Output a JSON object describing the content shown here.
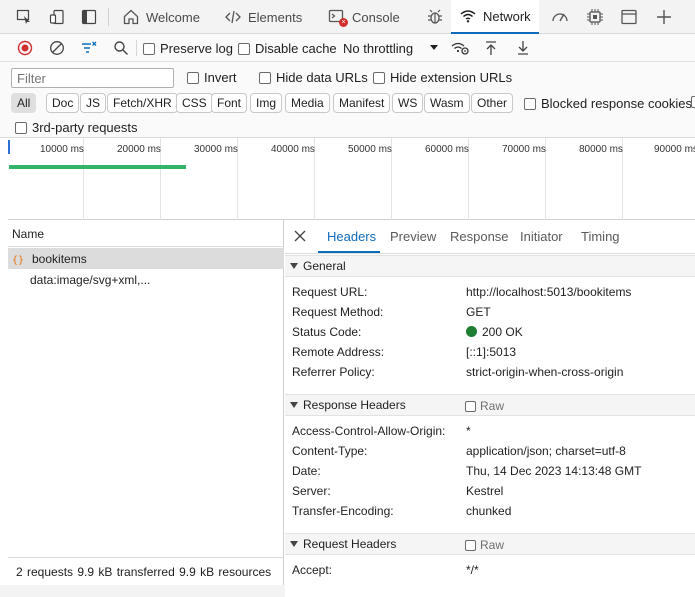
{
  "tabbar": {
    "tabs": [
      {
        "label": "Welcome",
        "icon": "home-icon"
      },
      {
        "label": "Elements",
        "icon": "code-icon"
      },
      {
        "label": "Console",
        "icon": "console-icon"
      },
      {
        "label": "Network",
        "icon": "wifi-icon",
        "active": true
      }
    ]
  },
  "toolbar": {
    "preserve_log": "Preserve log",
    "disable_cache": "Disable cache",
    "throttling": "No throttling"
  },
  "filter": {
    "placeholder": "Filter",
    "invert": "Invert",
    "hide_data_urls": "Hide data URLs",
    "hide_extension_urls": "Hide extension URLs"
  },
  "type_filters": [
    "All",
    "Doc",
    "JS",
    "Fetch/XHR",
    "CSS",
    "Font",
    "Img",
    "Media",
    "Manifest",
    "WS",
    "Wasm",
    "Other"
  ],
  "blocked_response_cookies": "Blocked response cookies",
  "third_party": "3rd-party requests",
  "overview": {
    "ticks": [
      "10000 ms",
      "20000 ms",
      "30000 ms",
      "40000 ms",
      "50000 ms",
      "60000 ms",
      "70000 ms",
      "80000 ms",
      "90000 ms"
    ]
  },
  "requests": {
    "header": "Name",
    "items": [
      {
        "name": "bookitems",
        "icon": "fetch-braces-icon"
      },
      {
        "name": "data:image/svg+xml,..."
      }
    ],
    "summary": "2 requests  9.9 kB transferred  9.9 kB resources"
  },
  "detail": {
    "tabs": [
      "Headers",
      "Preview",
      "Response",
      "Initiator",
      "Timing"
    ],
    "general": {
      "title": "General",
      "rows": [
        {
          "key": "Request URL:",
          "value": "http://localhost:5013/bookitems"
        },
        {
          "key": "Request Method:",
          "value": "GET"
        },
        {
          "key": "Status Code:",
          "value": "200 OK"
        },
        {
          "key": "Remote Address:",
          "value": "[::1]:5013"
        },
        {
          "key": "Referrer Policy:",
          "value": "strict-origin-when-cross-origin"
        }
      ]
    },
    "response_headers": {
      "title": "Response Headers",
      "raw": "Raw",
      "rows": [
        {
          "key": "Access-Control-Allow-Origin:",
          "value": "*"
        },
        {
          "key": "Content-Type:",
          "value": "application/json; charset=utf-8"
        },
        {
          "key": "Date:",
          "value": "Thu, 14 Dec 2023 14:13:48 GMT"
        },
        {
          "key": "Server:",
          "value": "Kestrel"
        },
        {
          "key": "Transfer-Encoding:",
          "value": "chunked"
        }
      ]
    },
    "request_headers": {
      "title": "Request Headers",
      "raw": "Raw",
      "rows": [
        {
          "key": "Accept:",
          "value": "*/*"
        }
      ]
    }
  },
  "colors": {
    "accent": "#0f6cbd",
    "status_ok": "#1e7e34",
    "timeline_bar": "#34b36b",
    "record": "#d32f2f"
  }
}
